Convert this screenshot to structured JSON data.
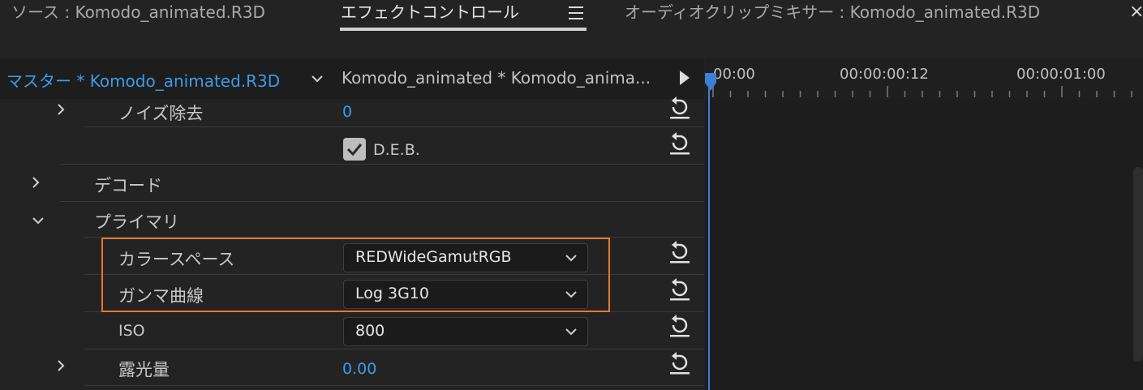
{
  "tabs": {
    "source": "ソース : Komodo_animated.R3D",
    "effect_controls": "エフェクトコントロール",
    "audio_mixer": "オーディオクリップミキサー : Komodo_animated.R3D",
    "close": "×"
  },
  "header": {
    "master": "マスター * Komodo_animated.R3D",
    "clip": "Komodo_animated * Komodo_anima..."
  },
  "timeline": {
    "timecodes": [
      "00:00",
      "00:00:00:12",
      "00:00:01:00"
    ]
  },
  "rows": {
    "noise": {
      "label": "ノイズ除去",
      "value": "0"
    },
    "deb": {
      "label": "D.E.B.",
      "checked": true
    },
    "decode": {
      "label": "デコード"
    },
    "primary": {
      "label": "プライマリ"
    },
    "colorspace": {
      "label": "カラースペース",
      "value": "REDWideGamutRGB"
    },
    "gamma": {
      "label": "ガンマ曲線",
      "value": "Log 3G10"
    },
    "iso": {
      "label": "ISO",
      "value": "800"
    },
    "exposure": {
      "label": "露光量",
      "value": "0.00"
    }
  },
  "colors": {
    "accent_blue": "#3d9be9",
    "highlight_orange": "#e8782d",
    "background": "#232323"
  }
}
